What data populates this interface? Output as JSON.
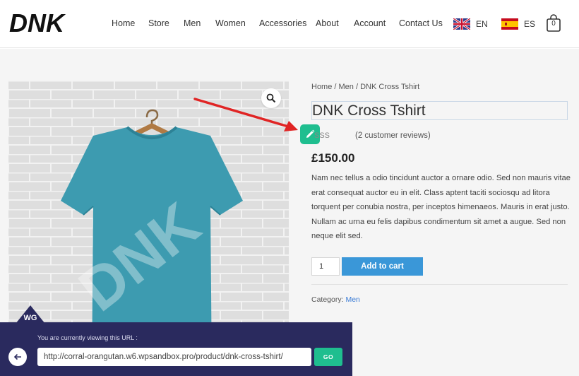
{
  "header": {
    "logo_text": "DNK",
    "nav": [
      "Home",
      "Store",
      "Men",
      "Women",
      "Accessories",
      "About",
      "Account",
      "Contact Us"
    ],
    "languages": [
      {
        "code": "EN",
        "flag": "uk-flag-icon"
      },
      {
        "code": "ES",
        "flag": "spain-flag-icon"
      }
    ],
    "cart_count": "0"
  },
  "product": {
    "image_brand_text": "DNK",
    "breadcrumb": {
      "home": "Home",
      "sep": " / ",
      "cat": "Men",
      "current": "DNK Cross Tshirt"
    },
    "title": "DNK Cross Tshirt",
    "rating_text": "SSS",
    "reviews": "(2 customer reviews)",
    "price": "£150.00",
    "description": "Nam nec tellus a odio tincidunt auctor a ornare odio. Sed non mauris vitae erat consequat auctor eu in elit. Class aptent taciti sociosqu ad litora torquent per conubia nostra, per inceptos himenaeos. Mauris in erat justo. Nullam ac urna eu felis dapibus condimentum sit amet a augue. Sed non neque elit sed.",
    "quantity": "1",
    "add_to_cart": "Add to cart",
    "category_label": "Category:",
    "category_value": "Men"
  },
  "banner": {
    "logo": "WG",
    "label": "You are currently viewing this URL :",
    "url": "http://corral-orangutan.w6.wpsandbox.pro/product/dnk-cross-tshirt/",
    "go": "GO"
  },
  "colors": {
    "accent_green": "#1fbe8f",
    "button_blue": "#3a97d8",
    "banner_bg": "#2a2a5e",
    "shirt": "#3d9bb0",
    "arrow": "#e02424"
  }
}
